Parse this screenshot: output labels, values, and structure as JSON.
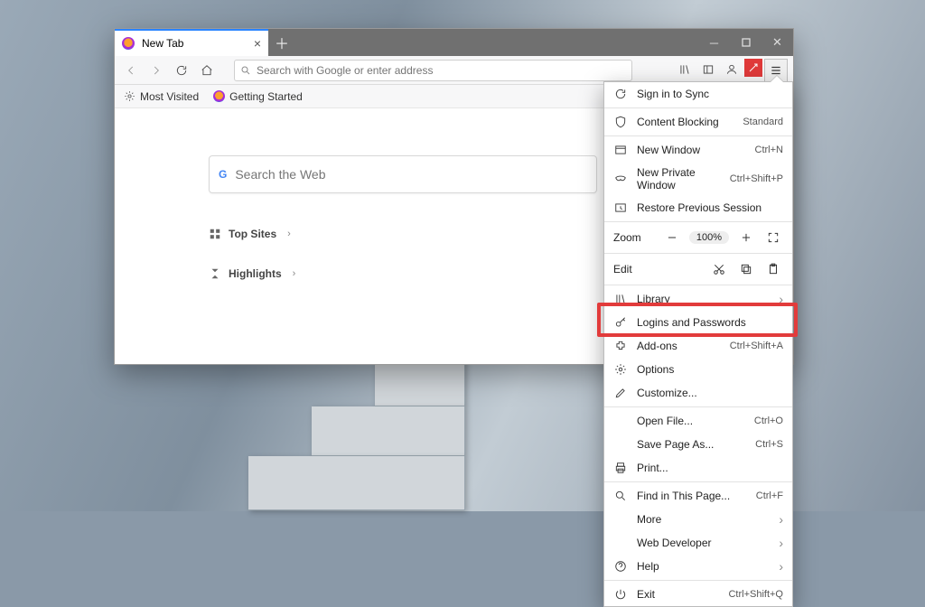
{
  "tab": {
    "title": "New Tab"
  },
  "urlbar": {
    "placeholder": "Search with Google or enter address"
  },
  "bookmarks": {
    "most_visited": "Most Visited",
    "getting_started": "Getting Started"
  },
  "newtab_page": {
    "search_placeholder": "Search the Web",
    "top_sites": "Top Sites",
    "highlights": "Highlights"
  },
  "menu": {
    "sign_in": "Sign in to Sync",
    "content_blocking": {
      "label": "Content Blocking",
      "value": "Standard"
    },
    "new_window": {
      "label": "New Window",
      "shortcut": "Ctrl+N"
    },
    "new_private": {
      "label": "New Private Window",
      "shortcut": "Ctrl+Shift+P"
    },
    "restore": "Restore Previous Session",
    "zoom": {
      "label": "Zoom",
      "value": "100%"
    },
    "edit": "Edit",
    "library": "Library",
    "logins": "Logins and Passwords",
    "addons": {
      "label": "Add-ons",
      "shortcut": "Ctrl+Shift+A"
    },
    "options": "Options",
    "customize": "Customize...",
    "open_file": {
      "label": "Open File...",
      "shortcut": "Ctrl+O"
    },
    "save_page": {
      "label": "Save Page As...",
      "shortcut": "Ctrl+S"
    },
    "print": "Print...",
    "find": {
      "label": "Find in This Page...",
      "shortcut": "Ctrl+F"
    },
    "more": "More",
    "webdev": "Web Developer",
    "help": "Help",
    "exit": {
      "label": "Exit",
      "shortcut": "Ctrl+Shift+Q"
    }
  }
}
